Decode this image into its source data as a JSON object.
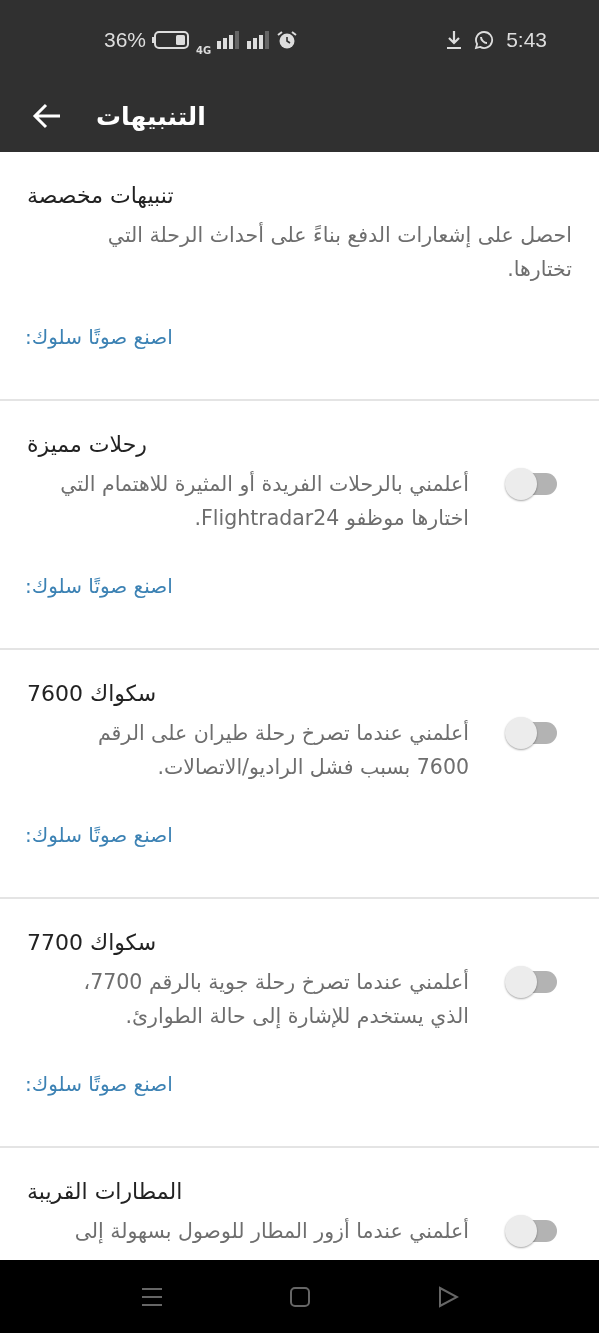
{
  "status_bar": {
    "battery": "36%",
    "network": "4G",
    "time": "5:43"
  },
  "toolbar": {
    "title": "التنبيهات"
  },
  "sections": [
    {
      "kind": "info",
      "title": "تنبيهات مخصصة",
      "description": "احصل على إشعارات الدفع بناءً على أحداث الرحلة التي تختارها.",
      "link": "اصنع صوتًا سلوك:"
    },
    {
      "kind": "toggle",
      "on": false,
      "title": "رحلات مميزة",
      "description": "أعلمني بالرحلات الفريدة أو المثيرة للاهتمام التي اختارها موظفو Flightradar24.",
      "link": "اصنع صوتًا سلوك:"
    },
    {
      "kind": "toggle",
      "on": false,
      "title": "سكواك 7600",
      "description": "أعلمني عندما تصرخ رحلة طيران على الرقم 7600 بسبب فشل الراديو/الاتصالات.",
      "link": "اصنع صوتًا سلوك:"
    },
    {
      "kind": "toggle",
      "on": false,
      "title": "سكواك 7700",
      "description": "أعلمني عندما تصرخ رحلة جوية بالرقم 7700، الذي يستخدم للإشارة إلى حالة الطوارئ.",
      "link": "اصنع صوتًا سلوك:"
    },
    {
      "kind": "toggle",
      "on": false,
      "title": "المطارات القريبة",
      "description": "أعلمني عندما أزور المطار للوصول بسهولة إلى"
    }
  ]
}
